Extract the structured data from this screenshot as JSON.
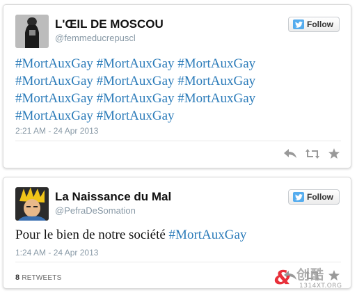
{
  "tweets": [
    {
      "display_name": "L'ŒIL DE MOSCOU",
      "handle": "@femmeducrepuscl",
      "follow_label": "Follow",
      "text_lines": [
        [
          "#MortAuxGay",
          "#MortAuxGay",
          "#MortAuxGay"
        ],
        [
          "#MortAuxGay",
          "#MortAuxGay",
          "#MortAuxGay"
        ],
        [
          "#MortAuxGay",
          "#MortAuxGay",
          "#MortAuxGay"
        ],
        [
          "#MortAuxGay",
          "#MortAuxGay"
        ]
      ],
      "timestamp": "2:21 AM - 24 Apr 2013"
    },
    {
      "display_name": "La Naissance du Mal",
      "handle": "@PefraDeSomation",
      "follow_label": "Follow",
      "text_plain": "Pour le bien de notre société",
      "text_hashtag": "#MortAuxGay",
      "timestamp": "1:24 AM - 24 Apr 2013",
      "retweet_count": "8",
      "retweet_label": "RETWEETS"
    }
  ],
  "watermark": {
    "symbol": "&",
    "text": "创酷",
    "url": "1314XT.ORG"
  },
  "colors": {
    "hashtag": "#2b7bb9",
    "meta": "#8899a6",
    "follow_bird": "#55acee",
    "action_icon": "#999999"
  },
  "icons": [
    "reply-icon",
    "retweet-icon",
    "favorite-icon",
    "twitter-bird-icon"
  ]
}
